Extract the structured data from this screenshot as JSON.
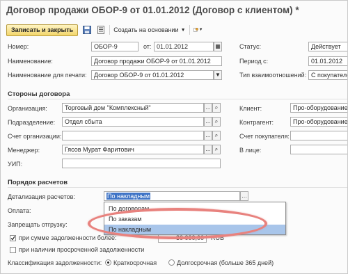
{
  "window": {
    "title": "Договор продажи ОБОР-9 от 01.01.2012 (Договор с клиентом) *"
  },
  "toolbar": {
    "save_close_label": "Записать и закрыть",
    "create_based_label": "Создать на основании",
    "save_icon": "floppy-disk-icon",
    "list_icon": "document-list-icon",
    "tools_icon": "tools-icon"
  },
  "header": {
    "number_label": "Номер:",
    "number_value": "ОБОР-9",
    "from_label": "от:",
    "date_value": "01.01.2012",
    "status_label": "Статус:",
    "status_value": "Действует",
    "name_label": "Наименование:",
    "name_value": "Договор продажи ОБОР-9 от 01.01.2012",
    "period_label": "Период с:",
    "period_value": "01.01.2012",
    "print_name_label": "Наименование для печати:",
    "print_name_value": "Договор ОБОР-9 от 01.01.2012",
    "relation_type_label": "Тип взаимоотношений:",
    "relation_type_value": "С покупателем"
  },
  "parties": {
    "section_title": "Стороны договора",
    "organization_label": "Организация:",
    "organization_value": "Торговый дом \"Комплексный\"",
    "client_label": "Клиент:",
    "client_value": "Про-оборудование",
    "department_label": "Подразделение:",
    "department_value": "Отдел сбыта",
    "counterparty_label": "Контрагент:",
    "counterparty_value": "Про-оборудование",
    "org_account_label": "Счет организации:",
    "org_account_value": "",
    "buyer_account_label": "Счет покупателя:",
    "buyer_account_value": "",
    "manager_label": "Менеджер:",
    "manager_value": "Гясов Мурат Фаритович",
    "in_person_label": "В лице:",
    "in_person_value": "",
    "uip_label": "УИП:",
    "uip_value": ""
  },
  "settlements": {
    "section_title": "Порядок расчетов",
    "detail_label": "Детализация расчетов:",
    "detail_value": "По накладным",
    "payment_label": "Оплата:",
    "forbid_shipment_label": "Запрещать отгрузку:",
    "debt_sum_label": "при сумме задолженности более:",
    "debt_sum_value": "30 000,00",
    "currency": "RUB",
    "overdue_label": "при наличии просроченной задолженности",
    "classification_label": "Классификация задолженности:",
    "short_term_label": "Краткосрочная",
    "long_term_label": "Долгосрочная (больше 365 дней)"
  },
  "dropdown": {
    "options": [
      "По договорам",
      "По заказам",
      "По накладным"
    ],
    "selected": "По накладным"
  },
  "colors": {
    "primary_button": "#f2d56a",
    "highlight": "#a8c5ea",
    "annotation": "#e8827e"
  }
}
